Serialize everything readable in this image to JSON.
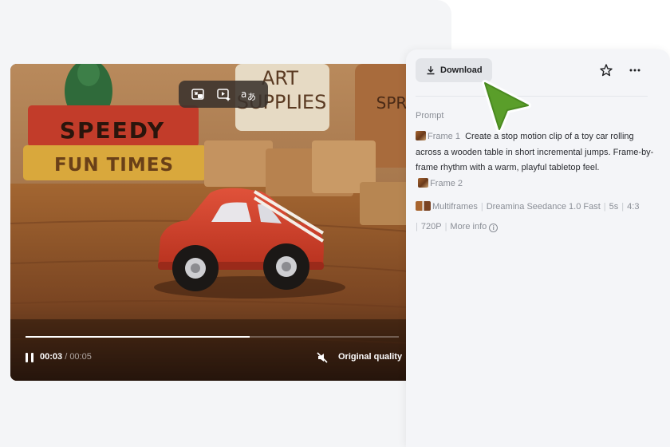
{
  "video": {
    "toolbar_icons": [
      "picture-in-picture-icon",
      "video-sparkle-icon",
      "translate-icon"
    ],
    "scene_text": {
      "book1": "SPEEDY",
      "book2": "FUN TIMES",
      "jar1_line1": "ART",
      "jar1_line2": "SUPPLIES",
      "jar2": "SPR"
    },
    "progress": 0.6,
    "time_current": "00:03",
    "time_total": "/ 00:05",
    "quality_label": "Original quality"
  },
  "panel": {
    "download_label": "Download",
    "prompt_label": "Prompt",
    "frame1_label": "Frame 1",
    "prompt_text": "Create a stop motion clip of a toy car rolling across a wooden table in short incremental jumps. Frame-by-frame rhythm with a warm, playful tabletop feel.",
    "frame2_label": "Frame 2",
    "meta": {
      "mode": "Multiframes",
      "model": "Dreamina Seedance 1.0 Fast",
      "duration": "5s",
      "ratio": "4:3",
      "resolution": "720P",
      "more_info": "More info"
    }
  },
  "colors": {
    "cursor": "#5a9e2a",
    "panel_bg": "#f4f5f8"
  }
}
